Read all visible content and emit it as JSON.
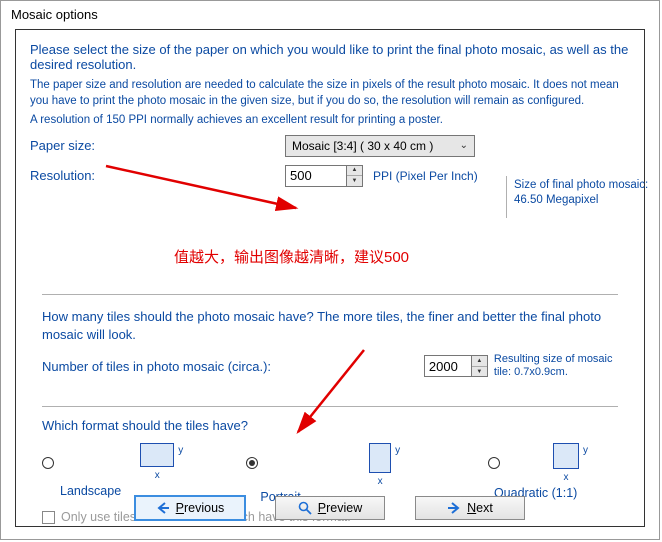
{
  "title": "Mosaic options",
  "intro_bold": "Please select the size of the paper on which you would like to print the final photo mosaic, as well as the desired resolution.",
  "intro_line2": "The paper size and resolution are needed to calculate the size in pixels of the result photo mosaic. It does not mean you have to print the photo mosaic in the given size, but if you do so, the resolution will remain as configured.",
  "intro_line3": "A resolution of 150 PPI normally achieves an excellent result for printing a poster.",
  "paper": {
    "label": "Paper size:",
    "select_value": "Mosaic [3:4]   ( 30 x 40 cm )"
  },
  "resolution": {
    "label": "Resolution:",
    "value": "500",
    "unit": "PPI (Pixel Per Inch)"
  },
  "side_info": {
    "line1": "Size of final photo mosaic:",
    "line2": "46.50 Megapixel"
  },
  "annotation_cn": "值越大，输出图像越清晰，建议500",
  "tiles": {
    "question": "How many tiles should the photo mosaic have? The more tiles, the finer and better the final photo mosaic will look.",
    "label": "Number of tiles in photo mosaic (circa.):",
    "value": "2000",
    "result_label": "Resulting size of mosaic tile:",
    "result_value": "0.7x0.9cm."
  },
  "format": {
    "question": "Which format should the tiles have?",
    "options": {
      "landscape": "Landscape",
      "portrait": "Portrait",
      "quadratic": "Quadratic (1:1)"
    },
    "axis_x": "x",
    "axis_y": "y"
  },
  "only_tiles": "Only use tiles from database which have this format.",
  "buttons": {
    "previous": "Previous",
    "preview": "Preview",
    "next": "Next",
    "p": "P",
    "n": "N"
  }
}
